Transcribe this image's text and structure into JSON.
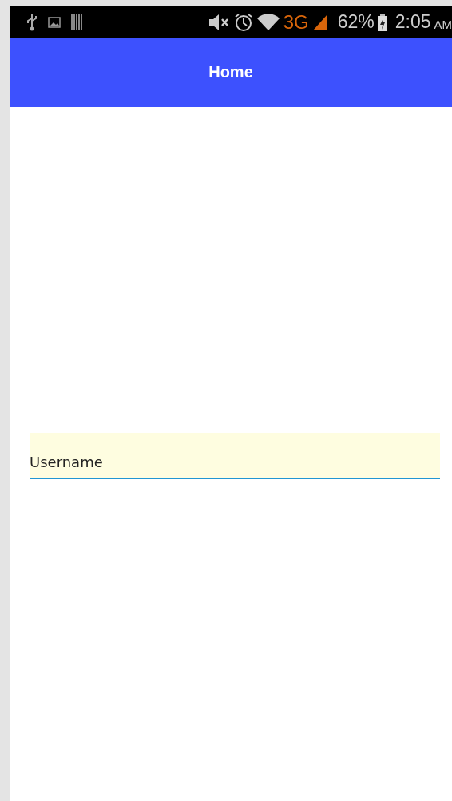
{
  "status_bar": {
    "network": "3G",
    "battery": "62%",
    "time": "2:05",
    "meridiem": "AM"
  },
  "app_bar": {
    "title": "Home"
  },
  "username_field": {
    "value": "Username",
    "focused": true
  }
}
